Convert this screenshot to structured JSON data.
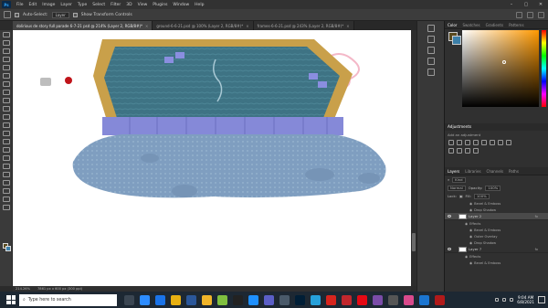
{
  "menubar": {
    "logo": "Ps",
    "items": [
      "File",
      "Edit",
      "Image",
      "Layer",
      "Type",
      "Select",
      "Filter",
      "3D",
      "View",
      "Plugins",
      "Window",
      "Help"
    ]
  },
  "options_bar": {
    "auto_select_label": "Auto-Select:",
    "auto_select_value": "Layer",
    "show_transform_label": "Show Transform Controls"
  },
  "document_tabs": [
    {
      "label": "dolirious de story full parade 6-7-21 psd @ 214% (Layer 2, RGB/8#)*",
      "active": true
    },
    {
      "label": "ground-6-6-21.psd @ 100% (Layer 2, RGB/8#)*",
      "active": false
    },
    {
      "label": "frames-6-6-21.psd @ 243% (Layer 2, RGB/8#)*",
      "active": false
    }
  ],
  "status_bar": {
    "zoom": "214.26%",
    "doc_info": "7861 px x 600 px (300 ppi)"
  },
  "color_panel": {
    "tabs": [
      "Color",
      "Swatches",
      "Gradients",
      "Patterns"
    ],
    "active_tab": "Color",
    "foreground": "#5a4a1e",
    "background": "#3c7fa8"
  },
  "adjustments_panel": {
    "title": "Adjustments",
    "subtitle": "Add an adjustment"
  },
  "layers_panel": {
    "tabs": [
      "Layers",
      "Libraries",
      "Channels",
      "Paths"
    ],
    "active_tab": "Layers",
    "filter_label": "Kind",
    "blend_mode": "Normal",
    "opacity_label": "Opacity:",
    "opacity_value": "100%",
    "lock_label": "Lock:",
    "fill_label": "Fill:",
    "fill_value": "100%",
    "rows": [
      {
        "type": "effect",
        "label": "Bevel & Emboss"
      },
      {
        "type": "effect",
        "label": "Drop Shadow"
      },
      {
        "type": "layer",
        "label": "Layer 2",
        "selected": true,
        "fx": "fx"
      },
      {
        "type": "effects-header",
        "label": "Effects"
      },
      {
        "type": "effect",
        "label": "Bevel & Emboss"
      },
      {
        "type": "effect",
        "label": "Outer Overlay"
      },
      {
        "type": "effect",
        "label": "Drop Shadow"
      },
      {
        "type": "layer",
        "label": "Layer 7",
        "selected": false,
        "fx": "fx"
      },
      {
        "type": "effects-header",
        "label": "Effects"
      },
      {
        "type": "effect",
        "label": "Bevel & Emboss"
      }
    ]
  },
  "taskbar": {
    "search_placeholder": "Type here to search",
    "time": "9:04 AM",
    "date": "6/8/2021",
    "icons": [
      {
        "name": "task-view-icon",
        "color": "#3b4652"
      },
      {
        "name": "zoom-icon",
        "color": "#2d8cff"
      },
      {
        "name": "mail-icon",
        "color": "#1a73e8"
      },
      {
        "name": "chrome-icon",
        "color": "#e8b012"
      },
      {
        "name": "word-icon",
        "color": "#2b579a"
      },
      {
        "name": "files-icon",
        "color": "#f0b429"
      },
      {
        "name": "paint-icon",
        "color": "#7fbf3f"
      },
      {
        "name": "dark-app-icon",
        "color": "#222222"
      },
      {
        "name": "edge-icon",
        "color": "#1e90ff"
      },
      {
        "name": "teams-icon",
        "color": "#5b5fc7"
      },
      {
        "name": "steam-icon",
        "color": "#4a5a6a"
      },
      {
        "name": "photoshop-icon",
        "color": "#001e36"
      },
      {
        "name": "photos-icon",
        "color": "#26a0da"
      },
      {
        "name": "acrobat-icon",
        "color": "#d7251e"
      },
      {
        "name": "media-icon",
        "color": "#c1272d"
      },
      {
        "name": "netflix-icon",
        "color": "#e50914"
      },
      {
        "name": "clipchamp-icon",
        "color": "#7a4ca8"
      },
      {
        "name": "terminal-icon",
        "color": "#555555"
      },
      {
        "name": "flower-icon",
        "color": "#d94a8c"
      },
      {
        "name": "explorer-icon",
        "color": "#1a75d1"
      },
      {
        "name": "record-icon",
        "color": "#b11a1a"
      }
    ]
  }
}
